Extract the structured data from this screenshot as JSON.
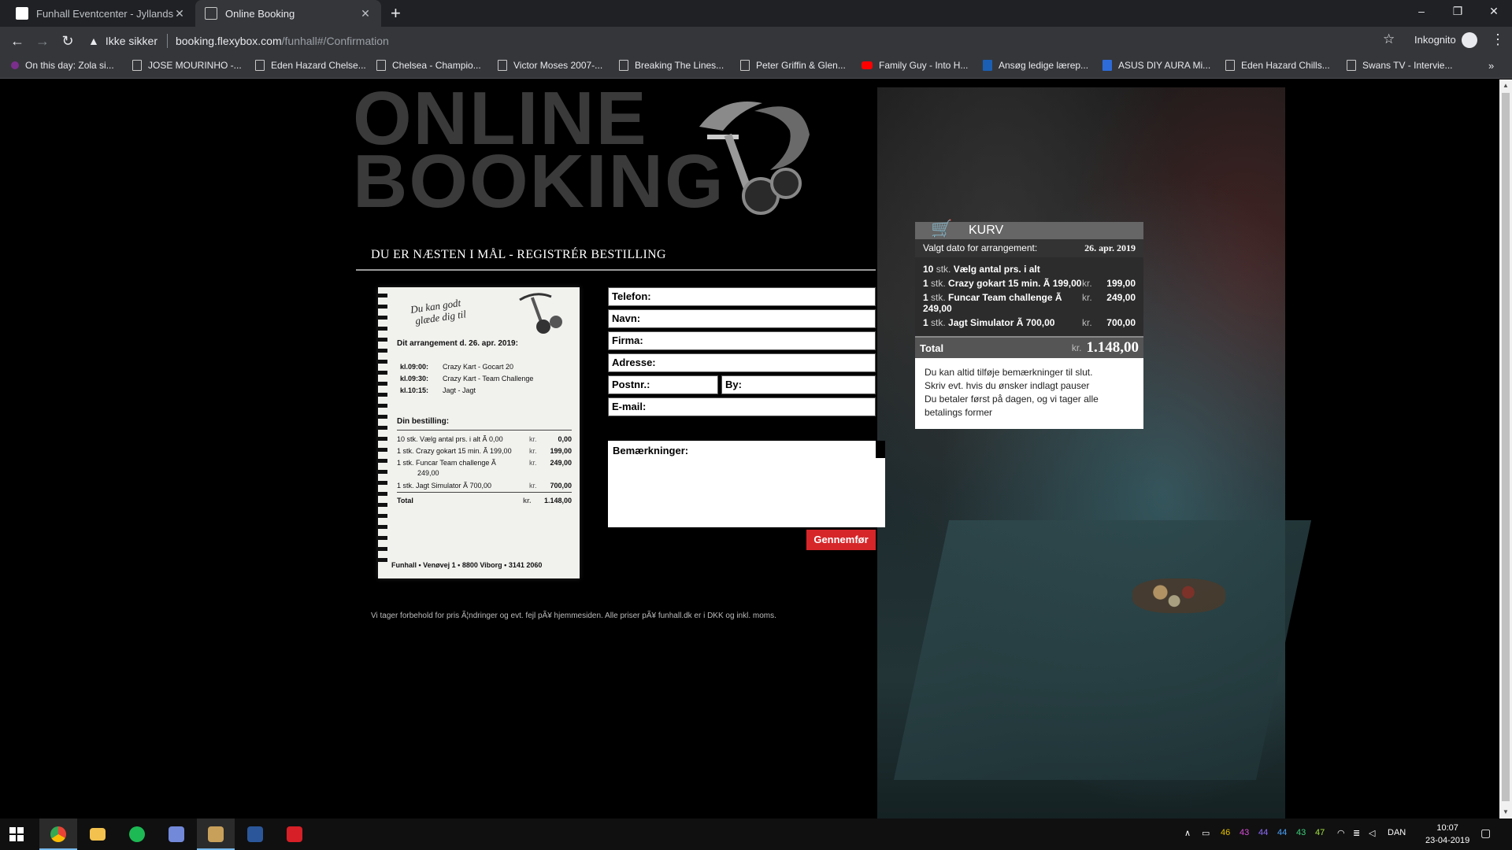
{
  "browser": {
    "tabs": [
      {
        "title": "Funhall Eventcenter - Jyllands sto",
        "active": false
      },
      {
        "title": "Online Booking",
        "active": true
      }
    ],
    "security_label": "Ikke sikker",
    "url_host": "booking.flexybox.com",
    "url_path": "/funhall#/Confirmation",
    "incognito_label": "Inkognito",
    "bookmarks": [
      "On this day: Zola si...",
      "JOSE MOURINHO -...",
      "Eden Hazard Chelse...",
      "Chelsea - Champio...",
      "Victor Moses 2007-...",
      "Breaking The Lines...",
      "Peter Griffin & Glen...",
      "Family Guy - Into H...",
      "Ansøg ledige lærep...",
      "ASUS DIY AURA Mi...",
      "Eden Hazard Chills...",
      "Swans TV - Intervie..."
    ]
  },
  "page": {
    "logo_line1": "ONLINE",
    "logo_line2": "BOOKING",
    "heading": "DU ER NÆSTEN I MÅL - REGISTRÉR BESTILLING",
    "receipt": {
      "handwriting_1": "Du kan godt",
      "handwriting_2": "glæde dig til",
      "event_heading": "Dit arrangement d. 26. apr. 2019:",
      "schedule": [
        {
          "time": "kl.09:00:",
          "activity": "Crazy Kart - Gocart 20"
        },
        {
          "time": "kl.09:30:",
          "activity": "Crazy Kart - Team Challenge"
        },
        {
          "time": "kl.10:15:",
          "activity": "Jagt - Jagt"
        }
      ],
      "order_heading": "Din bestilling:",
      "items": [
        {
          "desc": "10 stk. Vælg antal prs. i alt Ã  0,00",
          "kr": "kr.",
          "price": "0,00"
        },
        {
          "desc": "1 stk. Crazy gokart 15 min. Ã  199,00",
          "kr": "kr.",
          "price": "199,00"
        },
        {
          "desc": "1 stk. Funcar Team challenge Ã",
          "kr": "kr.",
          "price": "249,00"
        },
        {
          "desc": "249,00",
          "kr": "",
          "price": ""
        },
        {
          "desc": "1 stk. Jagt Simulator Ã  700,00",
          "kr": "kr.",
          "price": "700,00"
        }
      ],
      "total_label": "Total",
      "total_kr": "kr.",
      "total_value": "1.148,00",
      "footer": "Funhall • Venøvej 1 • 8800 Viborg • 3141 2060"
    },
    "form": {
      "telefon": "Telefon:",
      "navn": "Navn:",
      "firma": "Firma:",
      "adresse": "Adresse:",
      "postnr": "Postnr.:",
      "by": "By:",
      "email": "E-mail:",
      "bemaerkninger": "Bemærkninger:",
      "submit": "Gennemfør"
    },
    "disclaimer": "Vi tager forbehold for pris Ã¦ndringer og evt. fejl pÃ¥ hjemmesiden. Alle priser pÃ¥ funhall.dk er i DKK og inkl. moms.",
    "cart": {
      "title": "KURV",
      "date_label": "Valgt dato for arrangement:",
      "date_value": "26. apr. 2019",
      "items": [
        {
          "qty": "10",
          "unit": "stk.",
          "desc": "Vælg antal prs. i alt",
          "kr": "",
          "price": ""
        },
        {
          "qty": "1",
          "unit": "stk.",
          "desc": "Crazy gokart 15 min. Ã  199,00",
          "kr": "kr.",
          "price": "199,00"
        },
        {
          "qty": "1",
          "unit": "stk.",
          "desc": "Funcar Team challenge Ã  249,00",
          "kr": "kr.",
          "price": "249,00"
        },
        {
          "qty": "1",
          "unit": "stk.",
          "desc": "Jagt Simulator Ã  700,00",
          "kr": "kr.",
          "price": "700,00"
        }
      ],
      "total_label": "Total",
      "total_kr": "kr.",
      "total_value": "1.148,00",
      "note_lines": [
        "Du kan altid tilføje bemærkninger til slut.",
        "Skriv evt. hvis du ønsker indlagt pauser",
        "Du betaler først på dagen, og vi tager alle",
        "betalings former"
      ]
    }
  },
  "taskbar": {
    "tray_numbers": [
      "46",
      "43",
      "44",
      "44",
      "43",
      "47"
    ],
    "language": "DAN",
    "time": "10:07",
    "date": "23-04-2019"
  },
  "colors": {
    "submit_button": "#d6262a",
    "browser_dark": "#202124",
    "browser_toolbar": "#35363a"
  }
}
